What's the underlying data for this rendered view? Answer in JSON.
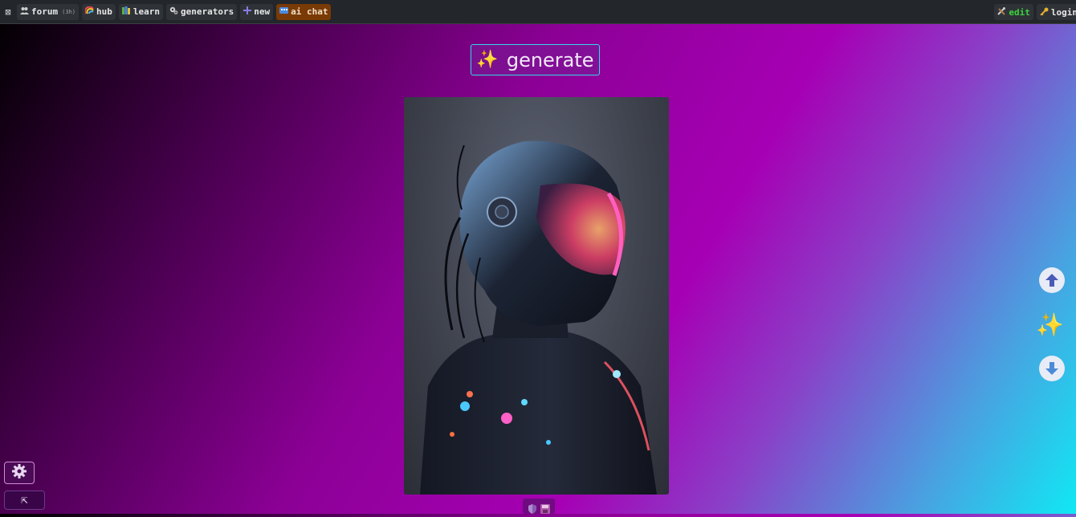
{
  "topbar": {
    "close_icon": "close-box-icon",
    "items": [
      {
        "label": "forum",
        "sub": "(3h)",
        "icon": "users-icon"
      },
      {
        "label": "hub",
        "icon": "rainbow-icon"
      },
      {
        "label": "learn",
        "icon": "books-icon"
      },
      {
        "label": "generators",
        "icon": "gears-icon"
      },
      {
        "label": "new",
        "icon": "plus-icon"
      },
      {
        "label": "ai chat",
        "icon": "chat-icon"
      }
    ],
    "right_items": [
      {
        "label": "edit",
        "icon": "tools-icon"
      },
      {
        "label": "login",
        "icon": "key-icon"
      }
    ]
  },
  "generate_button": {
    "label": "generate",
    "icon": "sparkles-icon"
  },
  "image": {
    "description_icon": "cyborg-portrait-image"
  },
  "image_tools": {
    "icons": [
      "shield-icon",
      "save-icon"
    ]
  },
  "side_controls": {
    "icons": [
      "scroll-up-icon",
      "sparkles-icon",
      "scroll-down-icon"
    ]
  },
  "bottom_controls": {
    "icons": [
      "gear-icon",
      "collapse-arrow-icon"
    ],
    "collapse_glyph": "⇱"
  },
  "colors": {
    "topbar_bg": "#23262b",
    "active_tab": "#7a3a05",
    "edit_text": "#3ad43a",
    "button_border": "#32d8ea",
    "gradient": [
      "#000000",
      "#8c0096",
      "#a600b4",
      "#10e8f4"
    ]
  }
}
